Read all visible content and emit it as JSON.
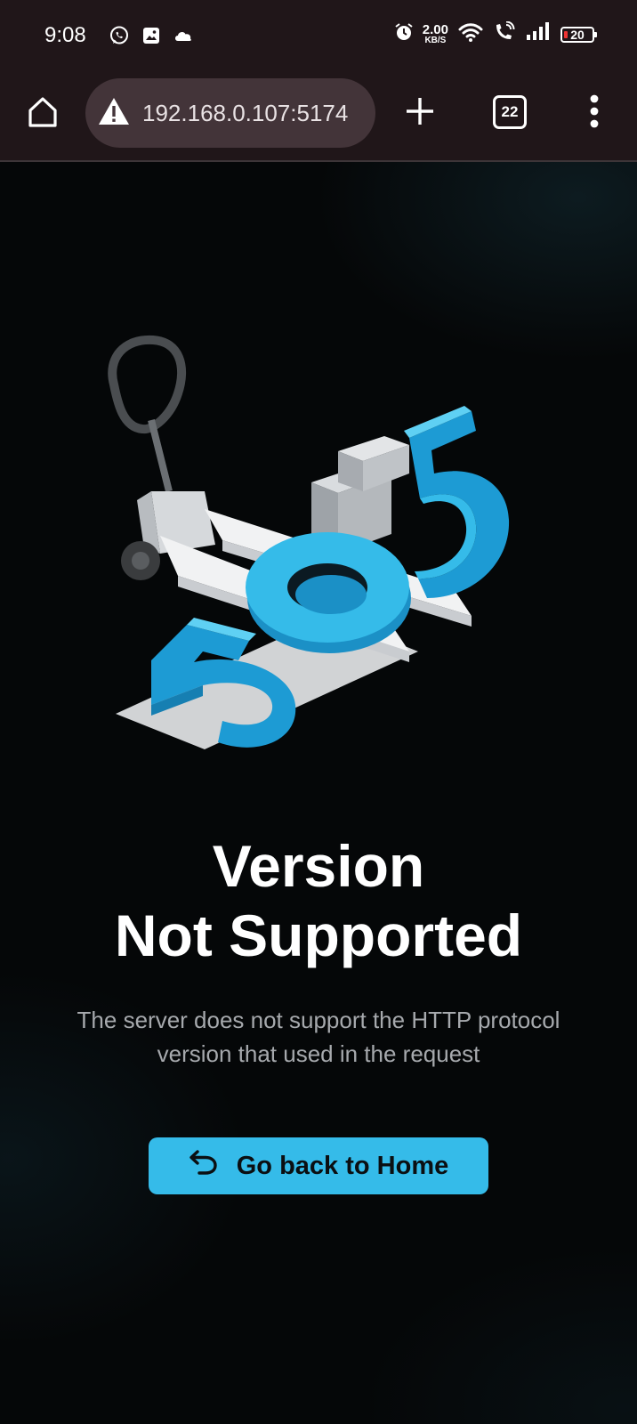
{
  "status_bar": {
    "time": "9:08",
    "net_speed_value": "2.00",
    "net_speed_unit": "KB/S",
    "battery_level": "20"
  },
  "browser": {
    "url": "192.168.0.107:5174",
    "tab_count": "22"
  },
  "page": {
    "illustration_code": "505",
    "title_line1": "Version",
    "title_line2": "Not Supported",
    "description_line1": "The server does not support the HTTP protocol",
    "description_line2": "version that used in the request",
    "button_label": "Go back to Home"
  },
  "colors": {
    "accent": "#35bbe9",
    "browser_bar": "#201619",
    "url_bar": "#433439",
    "page_background": "#050708"
  }
}
